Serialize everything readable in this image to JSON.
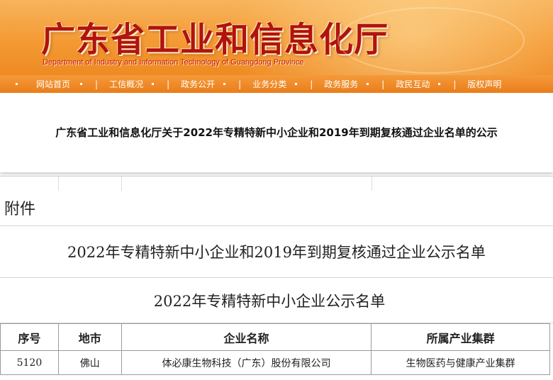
{
  "banner": {
    "title": "广东省工业和信息化厅",
    "subtitle": "Department of Industry and Information Technology of Guangdong Province"
  },
  "nav": {
    "items": [
      {
        "label": "网站首页"
      },
      {
        "label": "工信概况"
      },
      {
        "label": "政务公开"
      },
      {
        "label": "业务分类"
      },
      {
        "label": "政务服务"
      },
      {
        "label": "政民互动"
      },
      {
        "label": "版权声明"
      }
    ]
  },
  "notice": {
    "title": "广东省工业和信息化厅关于2022年专精特新中小企业和2019年到期复核通过企业名单的公示"
  },
  "document": {
    "attachment_label": "附件",
    "main_title": "2022年专精特新中小企业和2019年到期复核通过企业公示名单",
    "sub_title": "2022年专精特新中小企业公示名单",
    "table": {
      "headers": [
        "序号",
        "地市",
        "企业名称",
        "所属产业集群"
      ],
      "rows": [
        [
          "5120",
          "佛山",
          "体必康生物科技（广东）股份有限公司",
          "生物医药与健康产业集群"
        ]
      ]
    }
  }
}
